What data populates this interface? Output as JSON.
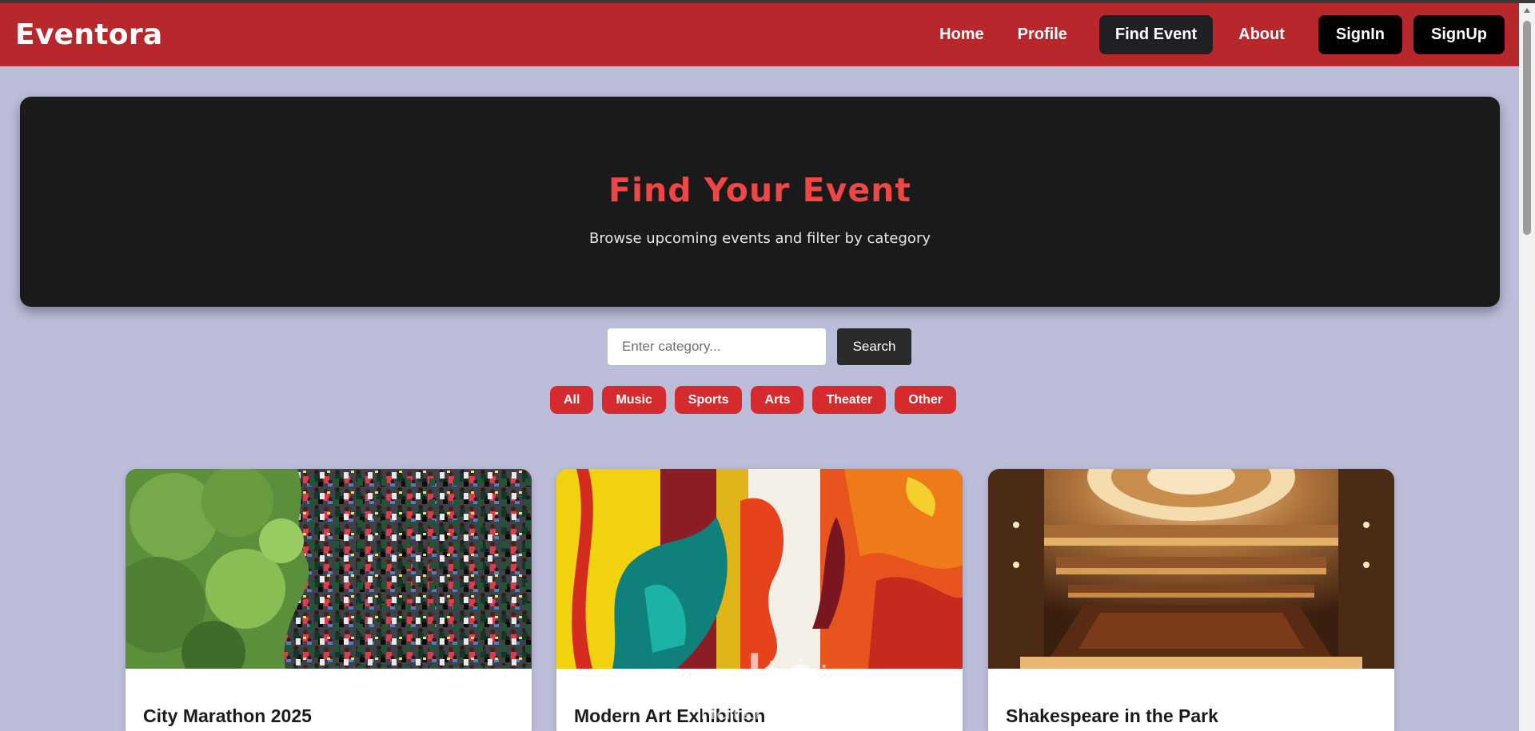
{
  "navbar": {
    "brand": "Eventora",
    "links": {
      "home": "Home",
      "profile": "Profile",
      "find_event": "Find Event",
      "about": "About"
    },
    "signin": "SignIn",
    "signup": "SignUp"
  },
  "hero": {
    "title": "Find Your Event",
    "subtitle": "Browse upcoming events and filter by category"
  },
  "search": {
    "placeholder": "Enter category...",
    "button": "Search"
  },
  "categories": [
    "All",
    "Music",
    "Sports",
    "Arts",
    "Theater",
    "Other"
  ],
  "events": [
    {
      "title": "City Marathon 2025"
    },
    {
      "title": "Modern Art Exhibition"
    },
    {
      "title": "Shakespeare in the Park"
    }
  ],
  "watermark": {
    "arabic": "نفذلي",
    "latin": "nafzly.com"
  },
  "colors": {
    "navbar": "#b7272c",
    "background": "#bcbdd9",
    "hero_bg": "#1a1a1a",
    "hero_title": "#ef4646",
    "chip": "#d52b2f",
    "active_link_bg": "#1f2023"
  }
}
